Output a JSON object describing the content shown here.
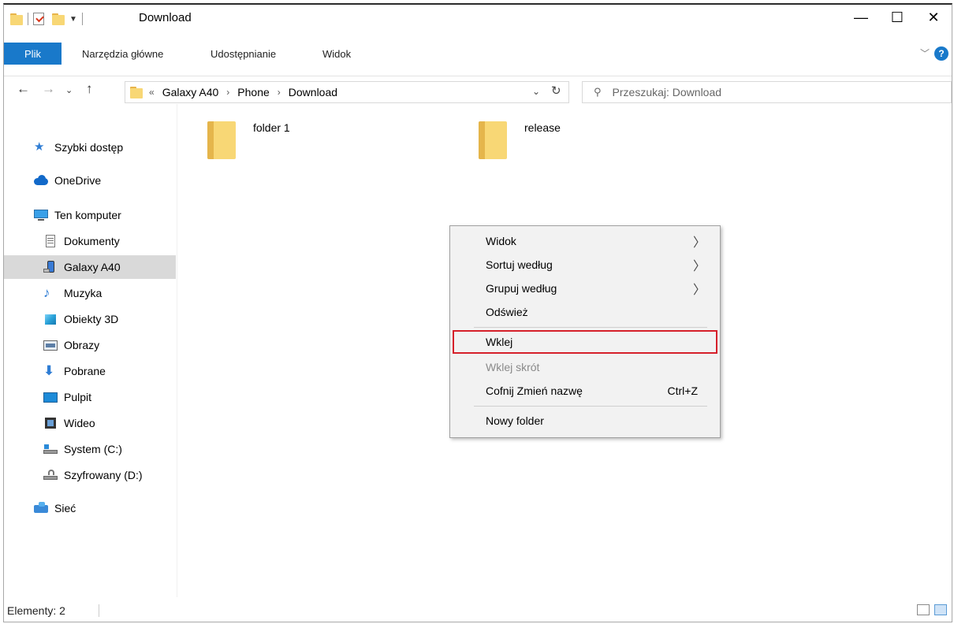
{
  "window": {
    "title": "Download"
  },
  "ribbon": {
    "file_tab": "Plik",
    "tabs": [
      "Narzędzia główne",
      "Udostępnianie",
      "Widok"
    ]
  },
  "address": {
    "overflow": "«",
    "crumbs": [
      "Galaxy A40",
      "Phone",
      "Download"
    ],
    "search_placeholder": "Przeszukaj: Download"
  },
  "nav": {
    "quick_access": "Szybki dostęp",
    "onedrive": "OneDrive",
    "this_pc": "Ten komputer",
    "items": [
      {
        "label": "Dokumenty",
        "icon": "documents-icon"
      },
      {
        "label": "Galaxy A40",
        "icon": "phone-icon",
        "selected": true
      },
      {
        "label": "Muzyka",
        "icon": "music-icon"
      },
      {
        "label": "Obiekty 3D",
        "icon": "3d-objects-icon"
      },
      {
        "label": "Obrazy",
        "icon": "pictures-icon"
      },
      {
        "label": "Pobrane",
        "icon": "downloads-icon"
      },
      {
        "label": "Pulpit",
        "icon": "desktop-icon"
      },
      {
        "label": "Wideo",
        "icon": "video-icon"
      },
      {
        "label": "System (C:)",
        "icon": "drive-icon"
      },
      {
        "label": "Szyfrowany (D:)",
        "icon": "encrypted-drive-icon"
      }
    ],
    "network": "Sieć"
  },
  "content": {
    "folders": [
      "folder 1",
      "release"
    ]
  },
  "context_menu": {
    "view": "Widok",
    "sort_by": "Sortuj według",
    "group_by": "Grupuj według",
    "refresh": "Odśwież",
    "paste": "Wklej",
    "paste_shortcut": "Wklej skrót",
    "undo_rename": "Cofnij Zmień nazwę",
    "undo_shortcut": "Ctrl+Z",
    "new_folder": "Nowy folder"
  },
  "status": {
    "count": "Elementy: 2"
  },
  "colors": {
    "accent": "#1979ca",
    "highlight_box": "#d6202a",
    "folder": "#f8d775"
  }
}
